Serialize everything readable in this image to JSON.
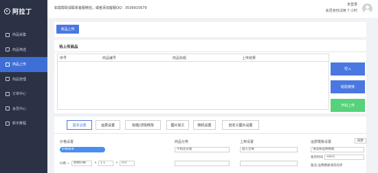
{
  "sidebar": {
    "logo": "阿拉丁",
    "items": [
      {
        "label": "商品采集",
        "active": false
      },
      {
        "label": "商品筛选",
        "active": false
      },
      {
        "label": "商品上传",
        "active": true
      },
      {
        "label": "商品管理",
        "active": false
      },
      {
        "label": "订单中心",
        "active": false
      },
      {
        "label": "会员中心",
        "active": false
      },
      {
        "label": "新手教程",
        "active": false
      }
    ]
  },
  "topbar": {
    "notice": "如需帮助请联系客服微信，或者添加客服QQ：3539915679",
    "user_name": "未登录",
    "user_status": "会员身份试用 7 小时"
  },
  "upload": {
    "button_label": "商品上传"
  },
  "pending": {
    "title": "待上传商品",
    "columns": [
      "序号",
      "商品编号",
      "商品标题",
      "上传结果"
    ],
    "rows": []
  },
  "actions": {
    "import_label": "导入",
    "paste_link_label": "粘贴链接",
    "start_label": "开始上传"
  },
  "settings": {
    "tabs": [
      "基本设置",
      "运费设置",
      "标题/详情修改",
      "图片加工",
      "随机设置",
      "自定义图片设置"
    ],
    "active_tab": 0,
    "groups": {
      "price": {
        "label": "价格设置",
        "mode_value": "价格倍率",
        "formula_prefix": "价格 =",
        "formula_source": "原始价格",
        "op_mul": "×",
        "mul_value": "1.1",
        "op_add": "+",
        "add_value": "0.0"
      },
      "category": {
        "label": "商品分类",
        "value": "不指定分类"
      },
      "listing": {
        "label": "上架设置",
        "value": "放入仓库"
      },
      "shipping": {
        "label": "运费模板设置",
        "sync_label": "同步",
        "template_value": "请选择运费模板",
        "delivery_label": "发货时间",
        "delivery_value": "3天内",
        "footer": "备注:运费模板请先同步"
      }
    }
  },
  "colors": {
    "sidebar_bg": "#2c3246",
    "accent": "#4a78e0",
    "start_green": "#55d27a"
  }
}
